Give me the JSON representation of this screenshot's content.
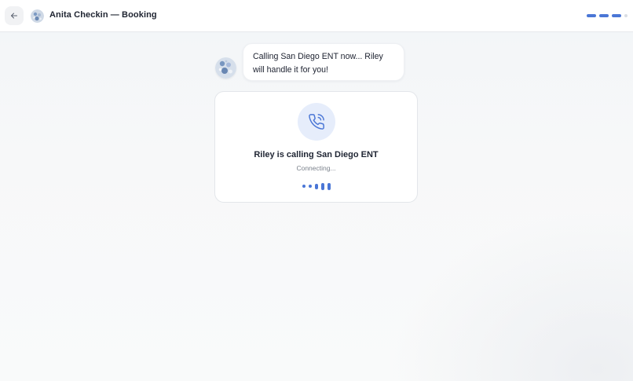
{
  "header": {
    "title": "Anita Checkin — Booking",
    "back_icon": "arrow-left-icon",
    "avatar_icon": "contact-avatar",
    "progress": {
      "completed_steps": 3,
      "total_steps": 4,
      "active_color": "#4a76d6",
      "pending_color": "#d9dde3"
    }
  },
  "chat": {
    "bot_avatar": "assistant-avatar",
    "message_lines": [
      "Calling San Diego ENT now... Riley",
      "will handle it for you!"
    ]
  },
  "call_card": {
    "icon": "phone-calling-icon",
    "title": "Riley is calling San Diego ENT",
    "status": "Connecting...",
    "wave_levels": [
      0.3,
      0.35,
      0.55,
      0.75,
      0.75
    ],
    "accent_color": "#4a76d6"
  }
}
